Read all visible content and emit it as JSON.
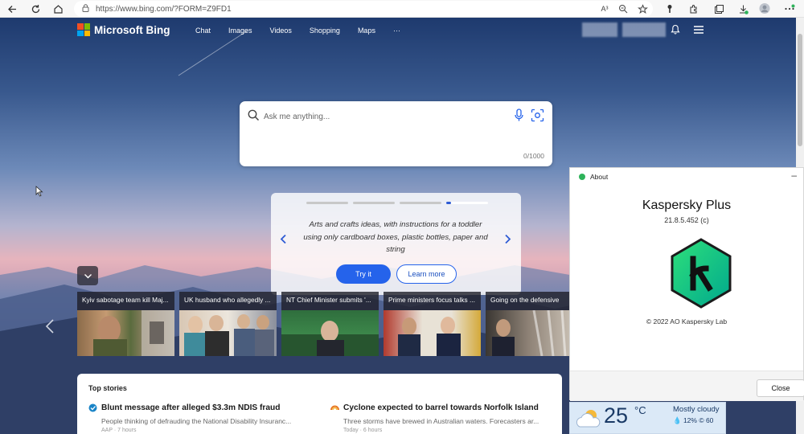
{
  "browser": {
    "url": "https://www.bing.com/?FORM=Z9FD1",
    "reader_label": "A³"
  },
  "bing": {
    "brand": "Microsoft Bing",
    "nav": [
      "Chat",
      "Images",
      "Videos",
      "Shopping",
      "Maps",
      "···"
    ],
    "search": {
      "placeholder": "Ask me anything...",
      "counter": "0/1000"
    },
    "suggestion": {
      "text": "Arts and crafts ideas, with instructions for a toddler using only cardboard boxes, plastic bottles, paper and string",
      "try_label": "Try it",
      "learn_label": "Learn more",
      "active_index": 3,
      "pages": 4
    },
    "news": [
      {
        "caption": "Kyiv sabotage team kill Maj..."
      },
      {
        "caption": "UK husband who allegedly ..."
      },
      {
        "caption": "NT Chief Minister submits '..."
      },
      {
        "caption": "Prime ministers focus talks ..."
      },
      {
        "caption": "Going on the defensive"
      }
    ],
    "top_stories": {
      "title": "Top stories",
      "items": [
        {
          "headline": "Blunt message after alleged $3.3m NDIS fraud",
          "summary": "People thinking of defrauding the National Disability Insuranc...",
          "source": "AAP · 7 hours"
        },
        {
          "headline": "Cyclone expected to barrel towards Norfolk Island",
          "summary": "Three storms have brewed in Australian waters. Forecasters ar...",
          "source": "Today · 6 hours"
        }
      ]
    },
    "weather": {
      "temp": "25",
      "unit": "°C",
      "condition": "Mostly cloudy",
      "meta": "💧 12%  © 60"
    }
  },
  "kaspersky": {
    "window_title": "About",
    "product": "Kaspersky Plus",
    "version": "21.8.5.452 (c)",
    "copyright": "© 2022 AO Kaspersky Lab",
    "close_label": "Close",
    "accent": "#00a88e"
  }
}
